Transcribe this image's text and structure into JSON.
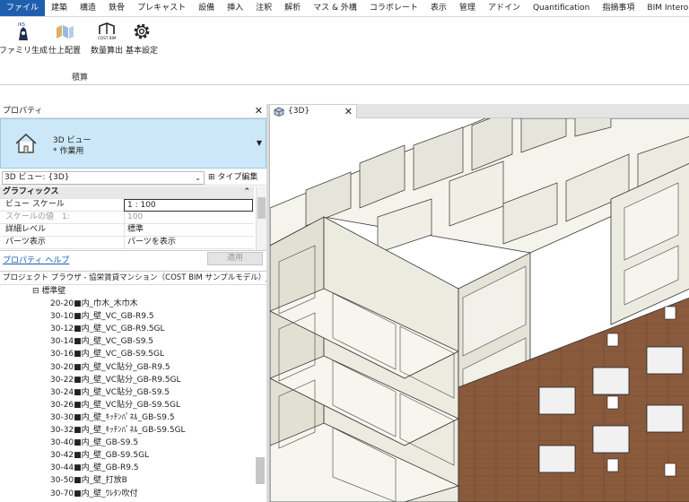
{
  "menu": {
    "tabs": [
      "ファイル",
      "建築",
      "構造",
      "鉄骨",
      "プレキャスト",
      "設備",
      "挿入",
      "注釈",
      "解析",
      "マス & 外構",
      "コラボレート",
      "表示",
      "管理",
      "アドイン",
      "Quantification",
      "指摘事項",
      "BIM Interopera"
    ]
  },
  "ribbon": {
    "buttons": [
      {
        "label": "ファミリ生成",
        "icon": "family-create-icon"
      },
      {
        "label": "仕上配置",
        "icon": "finish-place-icon"
      },
      {
        "label": "数量算出",
        "icon": "cost-bim-icon"
      },
      {
        "label": "基本設定",
        "icon": "gear-icon"
      }
    ],
    "brand_text": "COST BIM",
    "logo_text": "IKS",
    "panel_label": "積算"
  },
  "properties": {
    "title": "プロパティ",
    "type_line1": "3D ビュー",
    "type_line2": "* 作業用",
    "instance_selector": "3D ビュー: {3D}",
    "edit_type": "タイプ編集",
    "category": "グラフィックス",
    "rows": [
      {
        "key": "ビュー スケール",
        "value": "1 : 100"
      },
      {
        "key": "スケールの値　1:",
        "value": "100"
      },
      {
        "key": "詳細レベル",
        "value": "標準"
      },
      {
        "key": "パーツ表示",
        "value": "パーツを表示"
      }
    ],
    "help_link": "プロパティ ヘルプ",
    "apply": "適用"
  },
  "browser": {
    "title": "プロジェクト ブラウザ - 協栄賃貸マンション（COST BIM サンプルモデル）_...",
    "group": "標準壁",
    "items": [
      "20-20■内_巾木_木巾木",
      "30-10■内_壁_VC_GB-R9.5",
      "30-12■内_壁_VC_GB-R9.5GL",
      "30-14■内_壁_VC_GB-S9.5",
      "30-16■内_壁_VC_GB-S9.5GL",
      "30-20■内_壁_VC貼分_GB-R9.5",
      "30-22■内_壁_VC貼分_GB-R9.5GL",
      "30-24■内_壁_VC貼分_GB-S9.5",
      "30-26■内_壁_VC貼分_GB-S9.5GL",
      "30-30■内_壁_ｷｯﾁﾝﾊﾟﾈﾙ_GB-S9.5",
      "30-32■内_壁_ｷｯﾁﾝﾊﾟﾈﾙ_GB-S9.5GL",
      "30-40■内_壁_GB-S9.5",
      "30-42■内_壁_GB-S9.5GL",
      "30-44■内_壁_GB-R9.5",
      "30-50■内_壁_打放B",
      "30-70■内_壁_ｳﾚﾀﾝ吹付"
    ]
  },
  "view": {
    "tab_label": "{3D}"
  }
}
